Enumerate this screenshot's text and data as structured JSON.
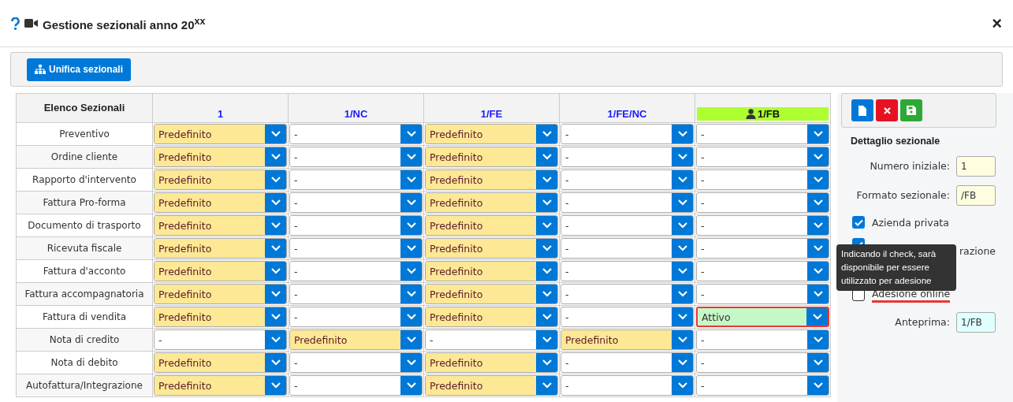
{
  "window": {
    "title": "Gestione sezionali anno 20$^{xx}$",
    "close": "×"
  },
  "toolbar": {
    "button": "Unifica sezionali"
  },
  "table": {
    "header": "Elenco Sezionali",
    "columns": [
      {
        "label": "1",
        "selected": false
      },
      {
        "label": "1/NC",
        "selected": false
      },
      {
        "label": "1/FE",
        "selected": false
      },
      {
        "label": "1/FE/NC",
        "selected": false
      },
      {
        "label": "1/FB",
        "selected": true
      }
    ],
    "rows": [
      {
        "name": "Preventivo",
        "cells": [
          {
            "value": "Predefinito",
            "kind": "default",
            "highlighted": false
          },
          {
            "value": "-",
            "kind": "none",
            "highlighted": false
          },
          {
            "value": "Predefinito",
            "kind": "default",
            "highlighted": false
          },
          {
            "value": "-",
            "kind": "none",
            "highlighted": false
          },
          {
            "value": "-",
            "kind": "none",
            "highlighted": false
          }
        ]
      },
      {
        "name": "Ordine cliente",
        "cells": [
          {
            "value": "Predefinito",
            "kind": "default",
            "highlighted": false
          },
          {
            "value": "-",
            "kind": "none",
            "highlighted": false
          },
          {
            "value": "Predefinito",
            "kind": "default",
            "highlighted": false
          },
          {
            "value": "-",
            "kind": "none",
            "highlighted": false
          },
          {
            "value": "-",
            "kind": "none",
            "highlighted": false
          }
        ]
      },
      {
        "name": "Rapporto d'intervento",
        "cells": [
          {
            "value": "Predefinito",
            "kind": "default",
            "highlighted": false
          },
          {
            "value": "-",
            "kind": "none",
            "highlighted": false
          },
          {
            "value": "Predefinito",
            "kind": "default",
            "highlighted": false
          },
          {
            "value": "-",
            "kind": "none",
            "highlighted": false
          },
          {
            "value": "-",
            "kind": "none",
            "highlighted": false
          }
        ]
      },
      {
        "name": "Fattura Pro-forma",
        "cells": [
          {
            "value": "Predefinito",
            "kind": "default",
            "highlighted": false
          },
          {
            "value": "-",
            "kind": "none",
            "highlighted": false
          },
          {
            "value": "Predefinito",
            "kind": "default",
            "highlighted": false
          },
          {
            "value": "-",
            "kind": "none",
            "highlighted": false
          },
          {
            "value": "-",
            "kind": "none",
            "highlighted": false
          }
        ]
      },
      {
        "name": "Documento di trasporto",
        "cells": [
          {
            "value": "Predefinito",
            "kind": "default",
            "highlighted": false
          },
          {
            "value": "-",
            "kind": "none",
            "highlighted": false
          },
          {
            "value": "Predefinito",
            "kind": "default",
            "highlighted": false
          },
          {
            "value": "-",
            "kind": "none",
            "highlighted": false
          },
          {
            "value": "-",
            "kind": "none",
            "highlighted": false
          }
        ]
      },
      {
        "name": "Ricevuta fiscale",
        "cells": [
          {
            "value": "Predefinito",
            "kind": "default",
            "highlighted": false
          },
          {
            "value": "-",
            "kind": "none",
            "highlighted": false
          },
          {
            "value": "Predefinito",
            "kind": "default",
            "highlighted": false
          },
          {
            "value": "-",
            "kind": "none",
            "highlighted": false
          },
          {
            "value": "-",
            "kind": "none",
            "highlighted": false
          }
        ]
      },
      {
        "name": "Fattura d'acconto",
        "cells": [
          {
            "value": "Predefinito",
            "kind": "default",
            "highlighted": false
          },
          {
            "value": "-",
            "kind": "none",
            "highlighted": false
          },
          {
            "value": "Predefinito",
            "kind": "default",
            "highlighted": false
          },
          {
            "value": "-",
            "kind": "none",
            "highlighted": false
          },
          {
            "value": "-",
            "kind": "none",
            "highlighted": false
          }
        ]
      },
      {
        "name": "Fattura accompagnatoria",
        "cells": [
          {
            "value": "Predefinito",
            "kind": "default",
            "highlighted": false
          },
          {
            "value": "-",
            "kind": "none",
            "highlighted": false
          },
          {
            "value": "Predefinito",
            "kind": "default",
            "highlighted": false
          },
          {
            "value": "-",
            "kind": "none",
            "highlighted": false
          },
          {
            "value": "-",
            "kind": "none",
            "highlighted": false
          }
        ]
      },
      {
        "name": "Fattura di vendita",
        "cells": [
          {
            "value": "Predefinito",
            "kind": "default",
            "highlighted": false
          },
          {
            "value": "-",
            "kind": "none",
            "highlighted": false
          },
          {
            "value": "Predefinito",
            "kind": "default",
            "highlighted": false
          },
          {
            "value": "-",
            "kind": "none",
            "highlighted": false
          },
          {
            "value": "Attivo",
            "kind": "active",
            "highlighted": true
          }
        ]
      },
      {
        "name": "Nota di credito",
        "cells": [
          {
            "value": "-",
            "kind": "none",
            "highlighted": false
          },
          {
            "value": "Predefinito",
            "kind": "default",
            "highlighted": false
          },
          {
            "value": "-",
            "kind": "none",
            "highlighted": false
          },
          {
            "value": "Predefinito",
            "kind": "default",
            "highlighted": false
          },
          {
            "value": "-",
            "kind": "none",
            "highlighted": false
          }
        ]
      },
      {
        "name": "Nota di debito",
        "cells": [
          {
            "value": "Predefinito",
            "kind": "default",
            "highlighted": false
          },
          {
            "value": "-",
            "kind": "none",
            "highlighted": false
          },
          {
            "value": "Predefinito",
            "kind": "default",
            "highlighted": false
          },
          {
            "value": "-",
            "kind": "none",
            "highlighted": false
          },
          {
            "value": "-",
            "kind": "none",
            "highlighted": false
          }
        ]
      },
      {
        "name": "Autofattura/Integrazione",
        "cells": [
          {
            "value": "Predefinito",
            "kind": "default",
            "highlighted": false
          },
          {
            "value": "-",
            "kind": "none",
            "highlighted": false
          },
          {
            "value": "Predefinito",
            "kind": "default",
            "highlighted": false
          },
          {
            "value": "-",
            "kind": "none",
            "highlighted": false
          },
          {
            "value": "-",
            "kind": "none",
            "highlighted": false
          }
        ]
      }
    ]
  },
  "detail": {
    "title": "Dettaglio sezionale",
    "fields": [
      {
        "label": "Numero iniziale:",
        "value": "1"
      },
      {
        "label": "Formato sezionale:",
        "value": "/FB"
      }
    ],
    "checkboxes": [
      {
        "label": "Azienda privata",
        "checked": true,
        "highlighted": false
      },
      {
        "label": "razione",
        "checked": true,
        "highlighted": false
      },
      {
        "label": "Adesione online",
        "checked": false,
        "highlighted": true
      }
    ],
    "tooltip": "Indicando il check, sarà disponibile per essere utilizzato per adesione",
    "preview": {
      "label": "Anteprima:",
      "value": "1/FB"
    }
  }
}
